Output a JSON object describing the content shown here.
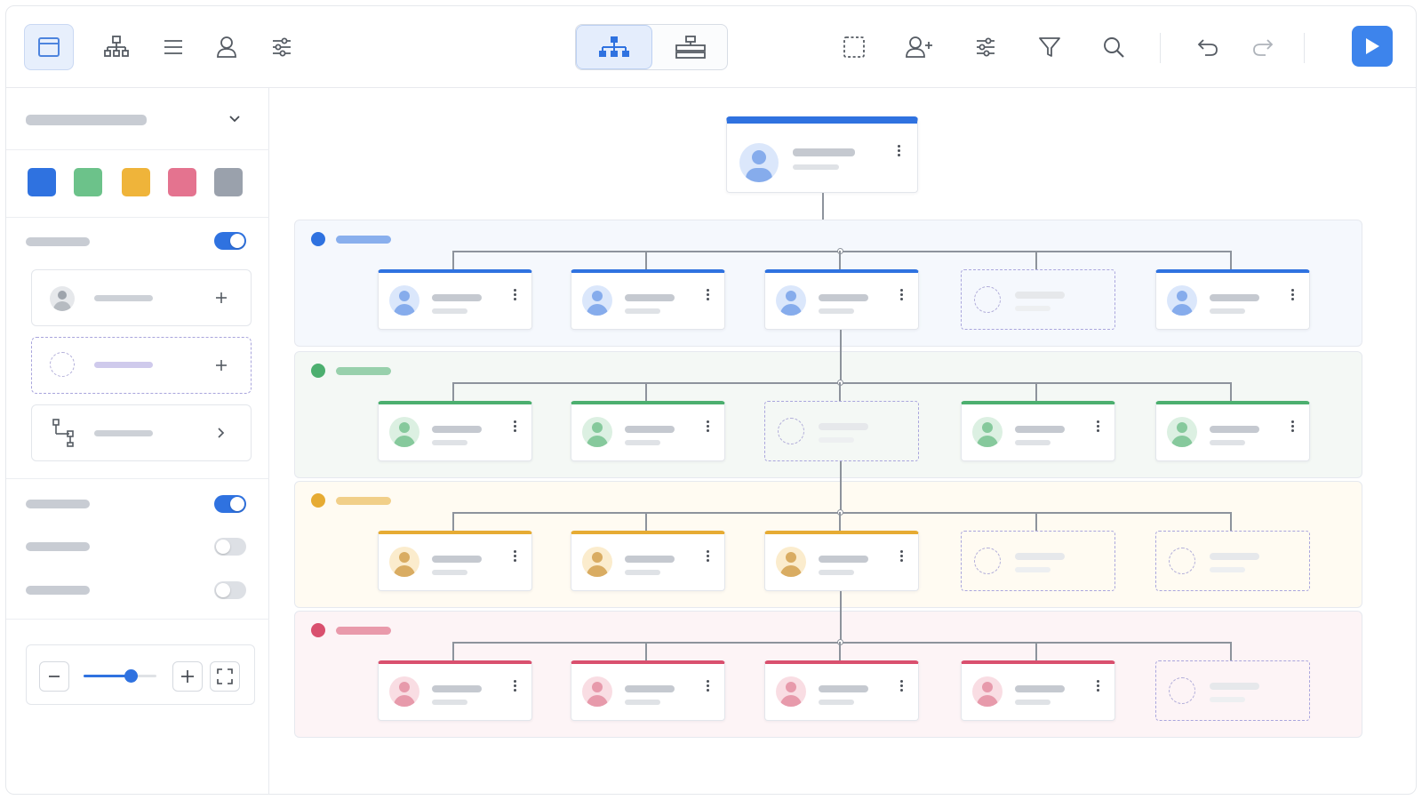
{
  "toolbar": {
    "left_tools": [
      {
        "name": "layout-panel-icon",
        "active": true
      },
      {
        "name": "org-tree-icon",
        "active": false
      },
      {
        "name": "list-icon",
        "active": false
      },
      {
        "name": "person-icon",
        "active": false
      },
      {
        "name": "sliders-icon",
        "active": false
      }
    ],
    "view_toggle": [
      {
        "name": "vertical-tree-view-icon",
        "selected": true
      },
      {
        "name": "horizontal-tree-view-icon",
        "selected": false
      }
    ],
    "right_tools": [
      "select-area-icon",
      "add-person-icon",
      "settings-sliders-icon",
      "filter-icon",
      "search-icon"
    ],
    "history": [
      "undo-icon",
      "redo-icon"
    ],
    "run": "play-icon",
    "accent": "#3d84ec"
  },
  "sidebar": {
    "swatches": [
      "#2f72e0",
      "#6cc28a",
      "#efb43a",
      "#e4738f",
      "#9aa1ac"
    ],
    "toggles": [
      {
        "name": "option-toggle-1",
        "on": true
      },
      {
        "name": "option-toggle-2",
        "on": true
      },
      {
        "name": "option-toggle-3",
        "on": false
      },
      {
        "name": "option-toggle-4",
        "on": false
      }
    ],
    "templates": [
      {
        "type": "person",
        "action": "add"
      },
      {
        "type": "vacancy",
        "action": "add"
      },
      {
        "type": "branch",
        "action": "open"
      }
    ],
    "zoom": {
      "level": 0.65
    }
  },
  "chart": {
    "levels": [
      {
        "color": "#2f72e0",
        "band_bg": "#f5f8fd",
        "avatar_bg": "#dbe7fb",
        "avatar_fg": "#86acec",
        "nodes": [
          "filled",
          "filled",
          "filled",
          "vacant",
          "filled"
        ]
      },
      {
        "color": "#4caf6f",
        "band_bg": "#f4f8f5",
        "avatar_bg": "#dcf0e2",
        "avatar_fg": "#86c99c",
        "nodes": [
          "filled",
          "filled",
          "vacant",
          "filled",
          "filled"
        ]
      },
      {
        "color": "#e6ab33",
        "band_bg": "#fffbf2",
        "avatar_bg": "#fbeccd",
        "avatar_fg": "#d9ac62",
        "nodes": [
          "filled",
          "filled",
          "filled",
          "vacant",
          "vacant"
        ]
      },
      {
        "color": "#d9506e",
        "band_bg": "#fdf4f6",
        "avatar_bg": "#f9dde3",
        "avatar_fg": "#e79aab",
        "nodes": [
          "filled",
          "filled",
          "filled",
          "filled",
          "vacant"
        ]
      }
    ]
  }
}
